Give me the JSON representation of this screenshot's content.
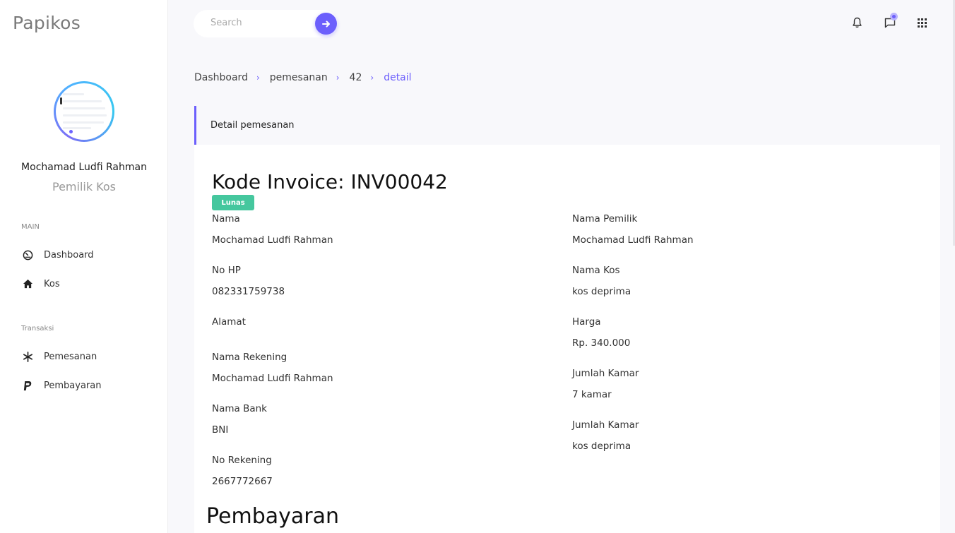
{
  "app": {
    "brand": "Papikos"
  },
  "user": {
    "name": "Mochamad Ludfi Rahman",
    "role": "Pemilik Kos"
  },
  "sidebar": {
    "sections": [
      {
        "title": "MAIN",
        "items": [
          {
            "label": "Dashboard",
            "icon": "dashboard-gauge-icon"
          },
          {
            "label": "Kos",
            "icon": "home-icon"
          }
        ]
      },
      {
        "title": "Transaksi",
        "items": [
          {
            "label": "Pemesanan",
            "icon": "asterisk-icon"
          },
          {
            "label": "Pembayaran",
            "icon": "paypal-icon"
          }
        ]
      }
    ]
  },
  "search": {
    "placeholder": "Search"
  },
  "breadcrumb": [
    "Dashboard",
    "pemesanan",
    "42",
    "detail"
  ],
  "card": {
    "header": "Detail pemesanan",
    "invoice_title": "Kode Invoice: INV00042",
    "status": "Lunas"
  },
  "details_left": [
    {
      "label": "Nama",
      "value": "Mochamad Ludfi Rahman"
    },
    {
      "label": "No HP",
      "value": "082331759738"
    },
    {
      "label": "Alamat",
      "value": ""
    },
    {
      "label": "Nama Rekening",
      "value": "Mochamad Ludfi Rahman"
    },
    {
      "label": "Nama Bank",
      "value": "BNI"
    },
    {
      "label": "No Rekening",
      "value": "2667772667"
    }
  ],
  "details_right": [
    {
      "label": "Nama Pemilik",
      "value": "Mochamad Ludfi Rahman"
    },
    {
      "label": "Nama Kos",
      "value": "kos deprima"
    },
    {
      "label": "Harga",
      "value": "Rp. 340.000"
    },
    {
      "label": "Jumlah Kamar",
      "value": "7 kamar"
    },
    {
      "label": "Jumlah Kamar",
      "value": "kos deprima"
    }
  ],
  "payment_section_title": "Pembayaran",
  "colors": {
    "accent": "#6c5ffc",
    "success": "#45c79e"
  }
}
